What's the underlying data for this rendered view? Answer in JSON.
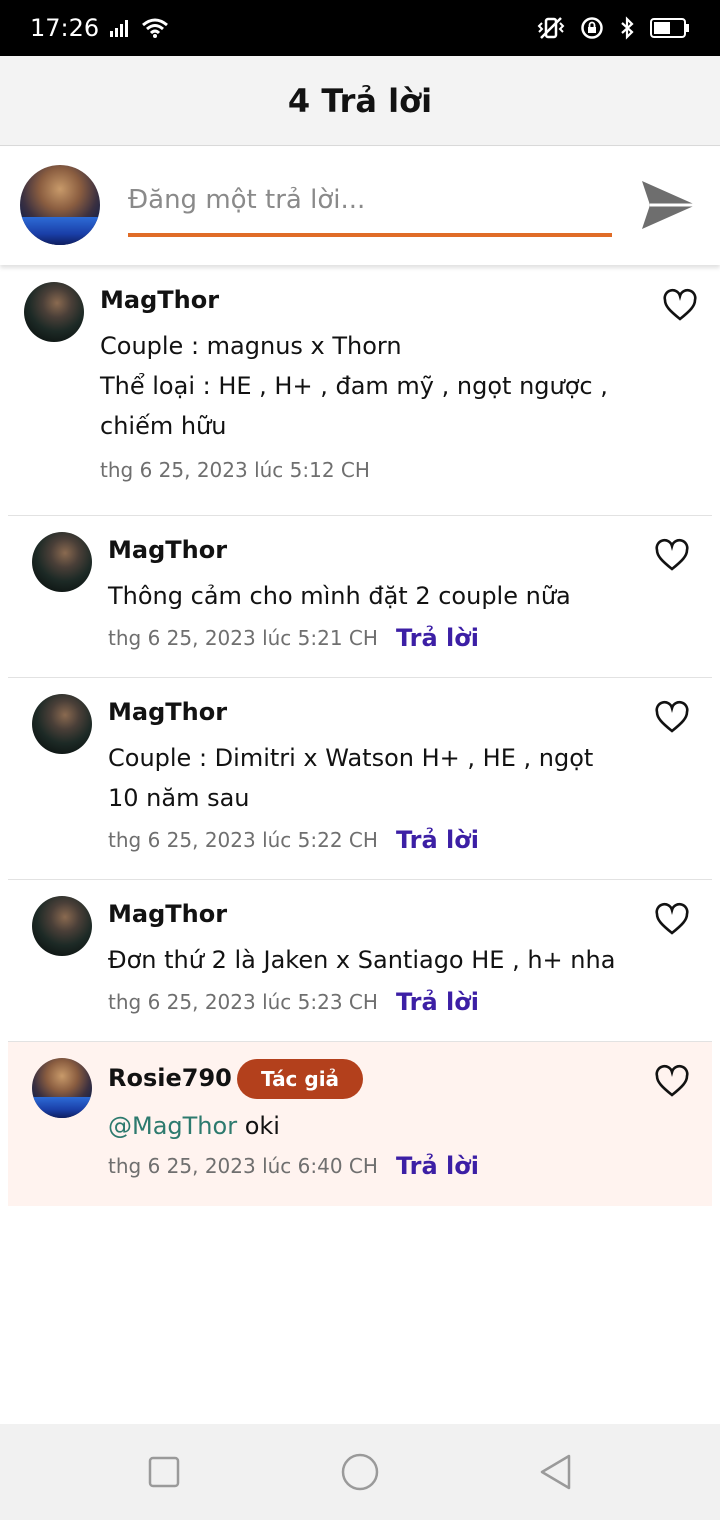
{
  "status_bar": {
    "time": "17:26",
    "icons": [
      "signal-icon",
      "wifi-icon",
      "vibrate-icon",
      "rotation-lock-icon",
      "bluetooth-icon",
      "battery-icon"
    ]
  },
  "header": {
    "title": "4 Trả lời"
  },
  "composer": {
    "placeholder": "Đăng một trả lời..."
  },
  "comments": [
    {
      "author": "MagThor",
      "lines": [
        "Couple : magnus x Thorn",
        "Thể loại : HE , H+ , đam mỹ , ngọt ngược ,",
        "chiếm hữu"
      ],
      "time": "thg 6 25, 2023 lúc 5:12 CH",
      "reply_label": ""
    },
    {
      "author": "MagThor",
      "lines": [
        "Thông cảm cho mình đặt 2 couple nữa"
      ],
      "time": "thg 6 25, 2023 lúc 5:21 CH",
      "reply_label": "Trả lời"
    },
    {
      "author": "MagThor",
      "lines": [
        "Couple : Dimitri x Watson H+ , HE , ngọt",
        "10 năm sau"
      ],
      "time": "thg 6 25, 2023 lúc 5:22 CH",
      "reply_label": "Trả lời"
    },
    {
      "author": "MagThor",
      "lines": [
        "Đơn thứ 2 là Jaken x Santiago HE , h+ nha"
      ],
      "time": "thg 6 25, 2023 lúc 5:23 CH",
      "reply_label": "Trả lời"
    },
    {
      "author": "Rosie790",
      "badge": "Tác giả",
      "mention": "@MagThor",
      "text": " oki",
      "time": "thg 6 25, 2023 lúc 6:40 CH",
      "reply_label": "Trả lời"
    }
  ],
  "colors": {
    "accent_underline": "#e06c27",
    "reply_link": "#3c1fa5",
    "author_badge": "#b3401c",
    "highlight_bg": "#fff3ef",
    "mention": "#2d7a6e"
  }
}
